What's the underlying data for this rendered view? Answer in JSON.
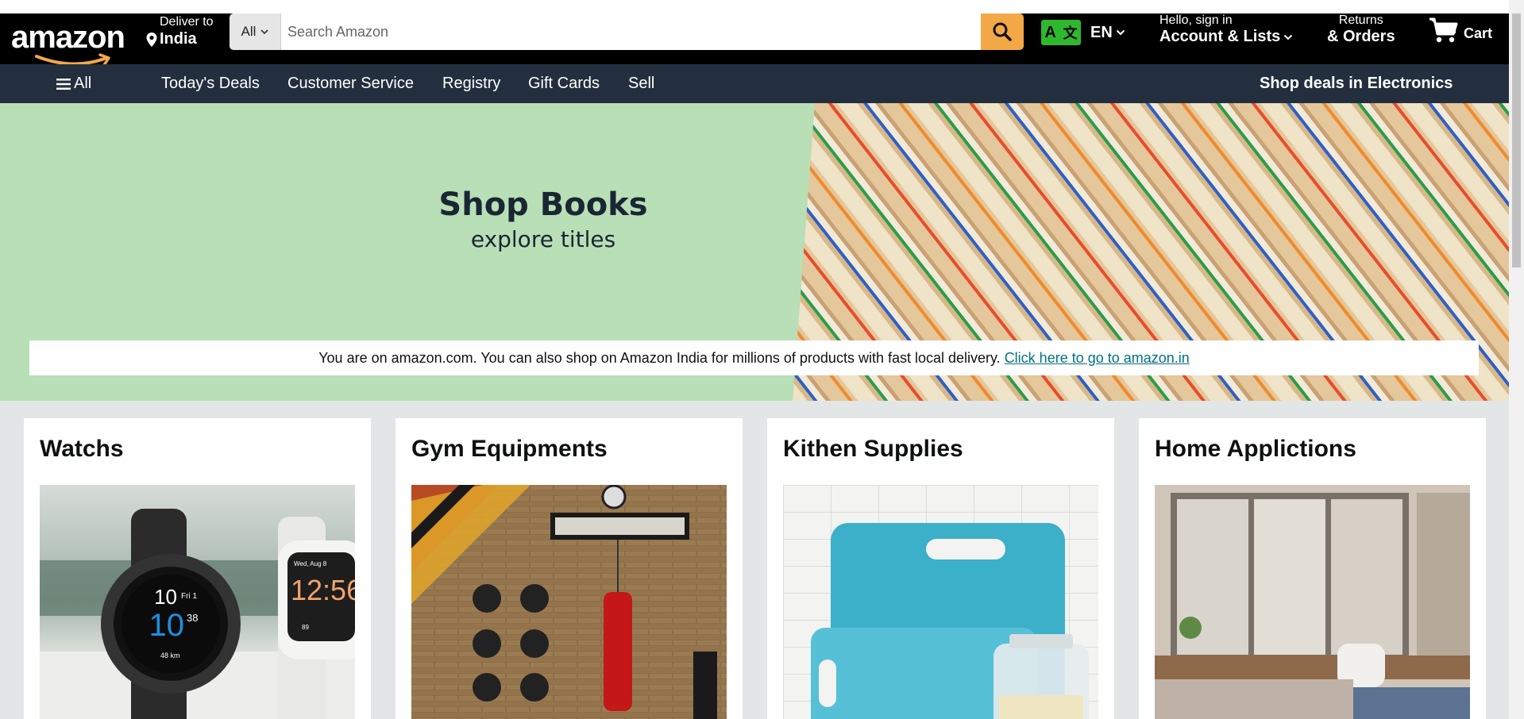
{
  "header": {
    "logo_text": "amazon",
    "deliver_label": "Deliver to",
    "deliver_location": "India",
    "search": {
      "category": "All",
      "placeholder": "Search Amazon"
    },
    "language": {
      "badge_left": "A",
      "badge_right": "文",
      "code": "EN"
    },
    "account": {
      "line1": "Hello, sign in",
      "line2": "Account & Lists"
    },
    "returns": {
      "line1": "Returns",
      "line2": "& Orders"
    },
    "cart_label": "Cart"
  },
  "nav": {
    "all_label": "All",
    "items": [
      "Today's Deals",
      "Customer Service",
      "Registry",
      "Gift Cards",
      "Sell"
    ],
    "promo": "Shop deals in Electronics"
  },
  "hero": {
    "title": "Shop Books",
    "subtitle": "explore titles"
  },
  "notice": {
    "text": "You are on amazon.com. You can also shop on Amazon India for millions of products with fast local delivery.",
    "link": "Click here to go to amazon.in"
  },
  "cards": [
    {
      "title": "Watchs"
    },
    {
      "title": "Gym Equipments"
    },
    {
      "title": "Kithen Supplies"
    },
    {
      "title": "Home Applictions"
    }
  ],
  "watch_faces": {
    "dark_top": "10",
    "dark_day": "Fri 1",
    "dark_main": "10",
    "dark_sec": "38",
    "dark_sub": "48 km",
    "light_date": "Wed, Aug 8",
    "light_time": "12:56",
    "light_sub": "89"
  },
  "colors": {
    "header_bg": "#000000",
    "nav_bg": "#232f3e",
    "search_button": "#f3a847",
    "hero_bg": "#b8dfb6",
    "link": "#007185",
    "lang_badge": "#2eb82e"
  },
  "icons": [
    "location-pin-icon",
    "search-icon",
    "chevron-down-icon",
    "cart-icon",
    "hamburger-icon",
    "language-icon"
  ]
}
